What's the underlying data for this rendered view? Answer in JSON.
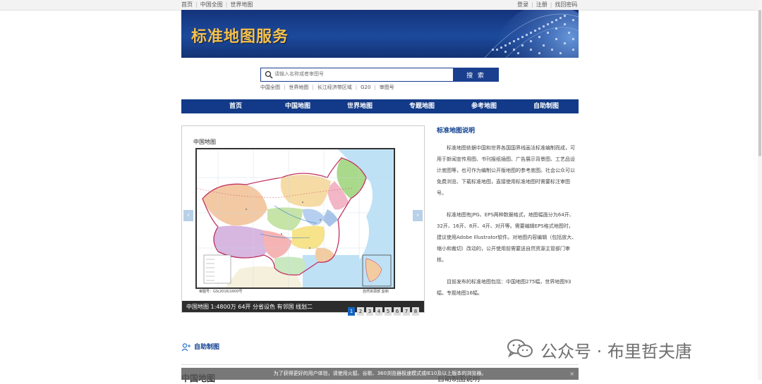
{
  "topbar": {
    "left_links": [
      "首页",
      "中国全图",
      "世界地图"
    ],
    "right_links": [
      "登录",
      "注册",
      "找回密码"
    ]
  },
  "banner": {
    "title": "标准地图服务"
  },
  "search": {
    "placeholder": "请输入名称或者审图号",
    "button_label": "搜 索",
    "quick_links": [
      "中国全图",
      "世界地图",
      "长江经济带区域",
      "G20",
      "审图号"
    ]
  },
  "nav": {
    "items": [
      "首页",
      "中国地图",
      "世界地图",
      "专题地图",
      "参考地图",
      "自助制图"
    ]
  },
  "carousel": {
    "map_title": "中国地图",
    "approval_no": "审图号：GS(2016)1600号",
    "publisher": "自然资源部 监制",
    "caption": "中国地图 1:4800万 64开 分省设色 有邻国 线划二",
    "pages": [
      "1",
      "2",
      "3",
      "4",
      "5",
      "6",
      "7",
      "8"
    ],
    "active_page": 0,
    "prev_label": "‹",
    "next_label": "›"
  },
  "description": {
    "title": "标准地图说明",
    "paragraphs": [
      "标准地图依据中国和世界各国国界线画法标准编制而成，可用于新闻宣传用图、书刊报纸插图、广告展示背景图、工艺品设计底图等，也可作为编制公开版地图的参考底图。社会公众可以免费浏览、下载标准地图，直接使用标准地图时需要标注审图号。",
      "标准地图有JPG、EPS两种数据格式，地图幅面分为64开、32开、16开、8开、4开、对开等。需要编辑EPS格式地图时，建议使用Adobe Illustrator软件。对地图内容编辑（包括放大、缩小和裁切）改动的，公开使用前需要送自然资源主管部门审核。",
      "目前发布的标准地图包括：中国地图275幅，世界地图93幅，专题地图16幅。"
    ]
  },
  "section": {
    "title": "自助制图",
    "partial_left": "中国地图",
    "partial_right": "自助制图说明"
  },
  "toast": {
    "message": "为了获得更好的用户体验，请使用火狐、谷歌、360浏览器极速模式或IE10及以上版本的浏览器。",
    "close_label": "×"
  },
  "watermark": {
    "text": "公众号 · 布里哲夫唐"
  },
  "colors": {
    "navy": "#123a88",
    "banner_gold": "#f5c04a",
    "accent_blue": "#1565c0"
  }
}
